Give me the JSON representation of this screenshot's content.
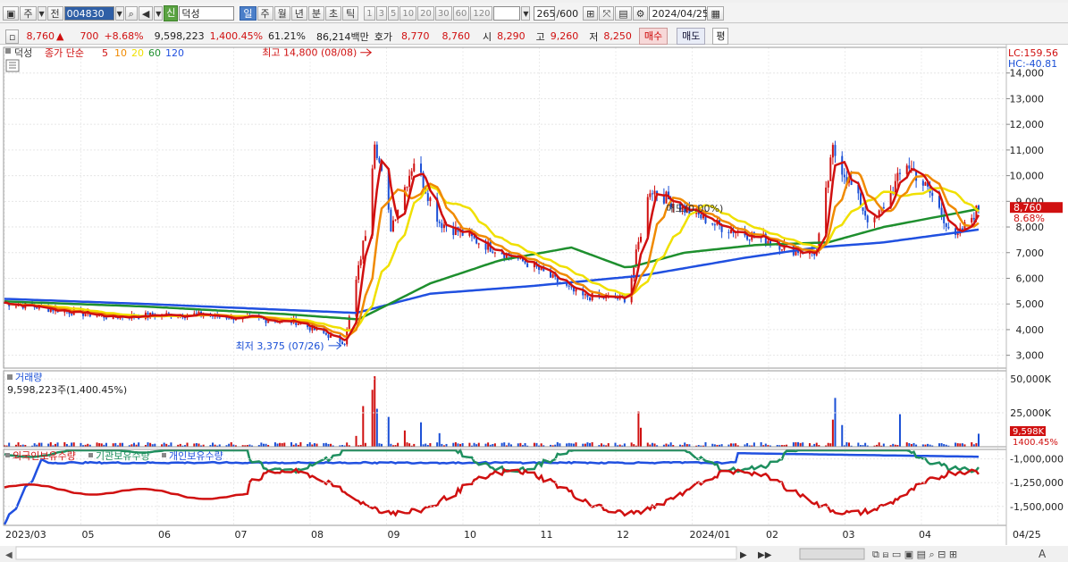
{
  "toolbar": {
    "type_label": "주",
    "prev_label": "전",
    "stock_code": "004830",
    "stock_badge": "신",
    "stock_name": "덕성",
    "periods": [
      "일",
      "주",
      "월",
      "년",
      "분",
      "초",
      "틱"
    ],
    "active_period": "일",
    "minutes": [
      "1",
      "3",
      "5",
      "10",
      "20",
      "30",
      "60",
      "120"
    ],
    "count": "265",
    "count_total": "/600",
    "date": "2024/04/25"
  },
  "quote": {
    "price": "8,760",
    "change_arrow": "▲",
    "change": "700",
    "change_pct": "+8.68%",
    "volume": "9,598,223",
    "volume_ratio": "1,400.45%",
    "turnover": "61.21%",
    "amount": "86,214백만",
    "ask_label": "호가",
    "ask1": "8,770",
    "ask2": "8,760",
    "open_label": "시",
    "open": "8,290",
    "high_label": "고",
    "high": "9,260",
    "low_label": "저",
    "low": "8,250",
    "buy_label": "매수",
    "sell_label": "매도",
    "eval_label": "평"
  },
  "chart_data": {
    "type": "line",
    "title": "덕성",
    "price_legend": "종가 단순",
    "ma_periods": [
      5,
      10,
      20,
      60,
      120
    ],
    "ma_colors": [
      "#d01010",
      "#f08a00",
      "#f0e000",
      "#1e8f2e",
      "#2050e0"
    ],
    "x_axis_labels": [
      "2023/03",
      "05",
      "06",
      "07",
      "08",
      "09",
      "10",
      "11",
      "12",
      "2024/01",
      "02",
      "03",
      "04",
      "04/25"
    ],
    "x_start": "2023-03-01",
    "x_end": "2024-04-25",
    "price_axis": {
      "min": 2500,
      "max": 15000,
      "ticks": [
        3000,
        4000,
        5000,
        6000,
        7000,
        8000,
        9000,
        10000,
        11000,
        12000,
        13000,
        14000
      ]
    },
    "price_axis_labels": [
      "3,000",
      "4,000",
      "5,000",
      "6,000",
      "7,000",
      "8,000",
      "9,000",
      "10,000",
      "11,000",
      "12,000",
      "13,000",
      "14,000"
    ],
    "lc": "LC:159.56",
    "hc": "HC:-40.81",
    "current_price": 8760,
    "current_price_label": "8,760",
    "current_pct_label": "8.68%",
    "annotations": {
      "high_label": "최고 14,800 (08/08)",
      "low_label": "최저 3,375 (07/26)",
      "mid_label": "매도(0.00%)"
    },
    "close_keypoints": [
      [
        "2023-03-01",
        5050
      ],
      [
        "2023-04-15",
        4500
      ],
      [
        "2023-05-20",
        4600
      ],
      [
        "2023-07-05",
        4300
      ],
      [
        "2023-07-26",
        3500
      ],
      [
        "2023-08-04",
        7800
      ],
      [
        "2023-08-08",
        11500
      ],
      [
        "2023-08-15",
        8000
      ],
      [
        "2023-08-25",
        10600
      ],
      [
        "2023-09-05",
        8200
      ],
      [
        "2023-09-20",
        7500
      ],
      [
        "2023-10-15",
        6500
      ],
      [
        "2023-11-05",
        5300
      ],
      [
        "2023-11-25",
        5200
      ],
      [
        "2023-12-05",
        9500
      ],
      [
        "2023-12-20",
        8700
      ],
      [
        "2024-01-05",
        8000
      ],
      [
        "2024-01-25",
        7500
      ],
      [
        "2024-02-05",
        7100
      ],
      [
        "2024-02-15",
        7000
      ],
      [
        "2024-02-22",
        11000
      ],
      [
        "2024-03-10",
        8000
      ],
      [
        "2024-03-25",
        10500
      ],
      [
        "2024-04-05",
        9200
      ],
      [
        "2024-04-15",
        7500
      ],
      [
        "2024-04-25",
        8760
      ]
    ],
    "ma60_keypoints": [
      [
        "2023-03-01",
        5100
      ],
      [
        "2023-05-01",
        4900
      ],
      [
        "2023-07-01",
        4600
      ],
      [
        "2023-08-01",
        4400
      ],
      [
        "2023-09-01",
        5800
      ],
      [
        "2023-10-01",
        6700
      ],
      [
        "2023-11-01",
        7200
      ],
      [
        "2023-11-25",
        6400
      ],
      [
        "2023-12-20",
        7000
      ],
      [
        "2024-01-20",
        7300
      ],
      [
        "2024-02-20",
        7400
      ],
      [
        "2024-03-15",
        8000
      ],
      [
        "2024-04-25",
        8700
      ]
    ],
    "ma120_keypoints": [
      [
        "2023-03-01",
        5200
      ],
      [
        "2023-05-01",
        5000
      ],
      [
        "2023-07-31",
        4650
      ],
      [
        "2023-09-01",
        5400
      ],
      [
        "2023-10-15",
        5700
      ],
      [
        "2023-12-01",
        6100
      ],
      [
        "2024-01-15",
        6800
      ],
      [
        "2024-02-15",
        7200
      ],
      [
        "2024-03-15",
        7400
      ],
      [
        "2024-04-25",
        7900
      ]
    ],
    "volume": {
      "title": "거래량",
      "info": "9,598,223주(1,400.45%)",
      "axis_labels": [
        "50,000K",
        "25,000K"
      ],
      "axis_ticks": [
        50000,
        25000
      ],
      "max": 56000,
      "last_label": "9,598K",
      "last_pct": "1400.45%",
      "spikes": [
        [
          "2023-07-31",
          8000
        ],
        [
          "2023-08-03",
          30000
        ],
        [
          "2023-08-07",
          42000
        ],
        [
          "2023-08-08",
          52000
        ],
        [
          "2023-08-09",
          28000
        ],
        [
          "2023-08-14",
          22000
        ],
        [
          "2023-08-21",
          12000
        ],
        [
          "2023-08-28",
          18000
        ],
        [
          "2023-09-05",
          10000
        ],
        [
          "2023-11-30",
          26000
        ],
        [
          "2023-12-01",
          14000
        ],
        [
          "2024-02-22",
          20000
        ],
        [
          "2024-02-23",
          36000
        ],
        [
          "2024-02-26",
          16000
        ],
        [
          "2024-03-22",
          24000
        ],
        [
          "2024-04-25",
          9598
        ]
      ]
    },
    "holdings": {
      "legend": [
        "외국인보유수량",
        "기관보유수량",
        "개인보유수량"
      ],
      "colors": [
        "#d01010",
        "#1e8f5e",
        "#2050e0"
      ],
      "axis_labels": [
        "-1,000,000",
        "-1,250,000",
        "-1,500,000"
      ],
      "axis_ticks": [
        -1000000,
        -1250000,
        -1500000
      ],
      "range": [
        -1700000,
        -900000
      ]
    }
  },
  "scrollbar": {
    "left_icon": "◀",
    "right_icon": "▶"
  }
}
